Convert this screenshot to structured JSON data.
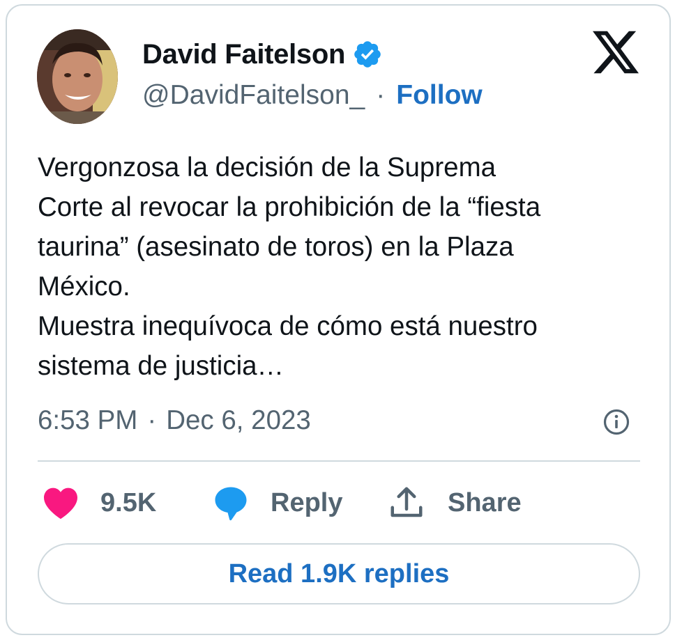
{
  "author": {
    "name": "David Faitelson",
    "handle": "@DavidFaitelson_",
    "separator": "·",
    "follow_label": "Follow"
  },
  "tweet": {
    "text": "Vergonzosa la decisión de la Suprema\nCorte al revocar la prohibición de la “fiesta\ntaurina” (asesinato de toros) en la Plaza\nMéxico.\nMuestra inequívoca de cómo está nuestro\nsistema de justicia…",
    "time": "6:53 PM",
    "separator": "·",
    "date": "Dec 6, 2023"
  },
  "actions": {
    "like_count": "9.5K",
    "reply_label": "Reply",
    "share_label": "Share"
  },
  "read_replies_label": "Read 1.9K replies",
  "colors": {
    "link_blue": "#1d6fc2",
    "verified_blue": "#1d9bf0",
    "heart_pink": "#f91880",
    "muted_gray": "#536471",
    "border": "#cfd9de"
  },
  "icons": [
    "verified-badge-icon",
    "x-logo-icon",
    "info-icon",
    "heart-icon",
    "reply-bubble-icon",
    "share-icon"
  ]
}
